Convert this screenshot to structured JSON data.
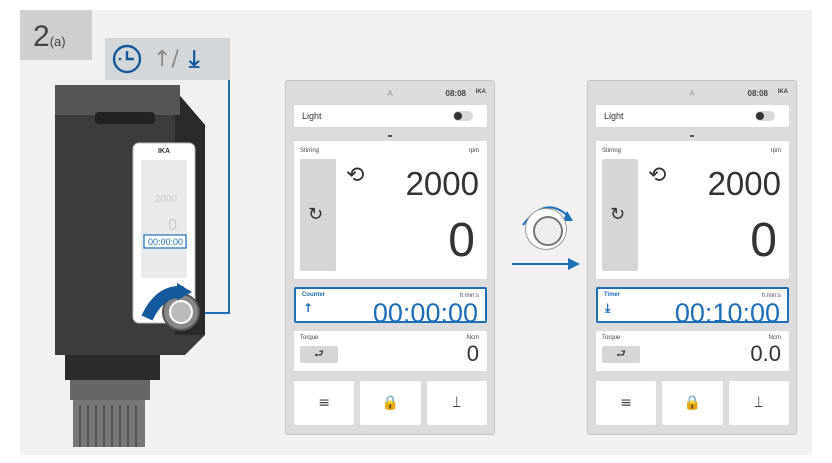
{
  "step": {
    "number": "2",
    "suffix": "(a)"
  },
  "icon_strip": {
    "icons": [
      "clock-icon",
      "arrow-up-icon",
      "arrow-down-to-line-icon"
    ],
    "separator": "↑/"
  },
  "device": {
    "brand": "IKA",
    "timer_value": "00:00:00",
    "rpm_hint": "2000",
    "zero_hint": "0"
  },
  "screens": [
    {
      "header_label": "A",
      "time": "08:08",
      "logo": "IKA",
      "light_label": "Light",
      "stirring_label": "Stirring",
      "stirring_unit": "rpm",
      "speed_value": "2000",
      "actual_value": "0",
      "counter_label": "Counter",
      "counter_unit": "h:min:s",
      "counter_value": "00:00:00",
      "counter_arrow": "↑",
      "torque_label": "Torque",
      "torque_unit": "Ncm",
      "torque_value": "0",
      "torque_button": "⮐",
      "buttons": [
        "≡",
        "🔒",
        "⟘"
      ]
    },
    {
      "header_label": "A",
      "time": "08:08",
      "logo": "IKA",
      "light_label": "Light",
      "stirring_label": "Stirring",
      "stirring_unit": "rpm",
      "speed_value": "2000",
      "actual_value": "0",
      "counter_label": "Timer",
      "counter_unit": "h:min:s",
      "counter_value": "00:10:00",
      "counter_arrow": "⤓",
      "torque_label": "Torque",
      "torque_unit": "Ncm",
      "torque_value": "0.0",
      "torque_button": "⮐",
      "buttons": [
        "≡",
        "🔒",
        "⟘"
      ]
    }
  ],
  "colors": {
    "accent": "#1d6fb8",
    "panel": "#f1f1f1",
    "screen": "#dcdcdc"
  }
}
